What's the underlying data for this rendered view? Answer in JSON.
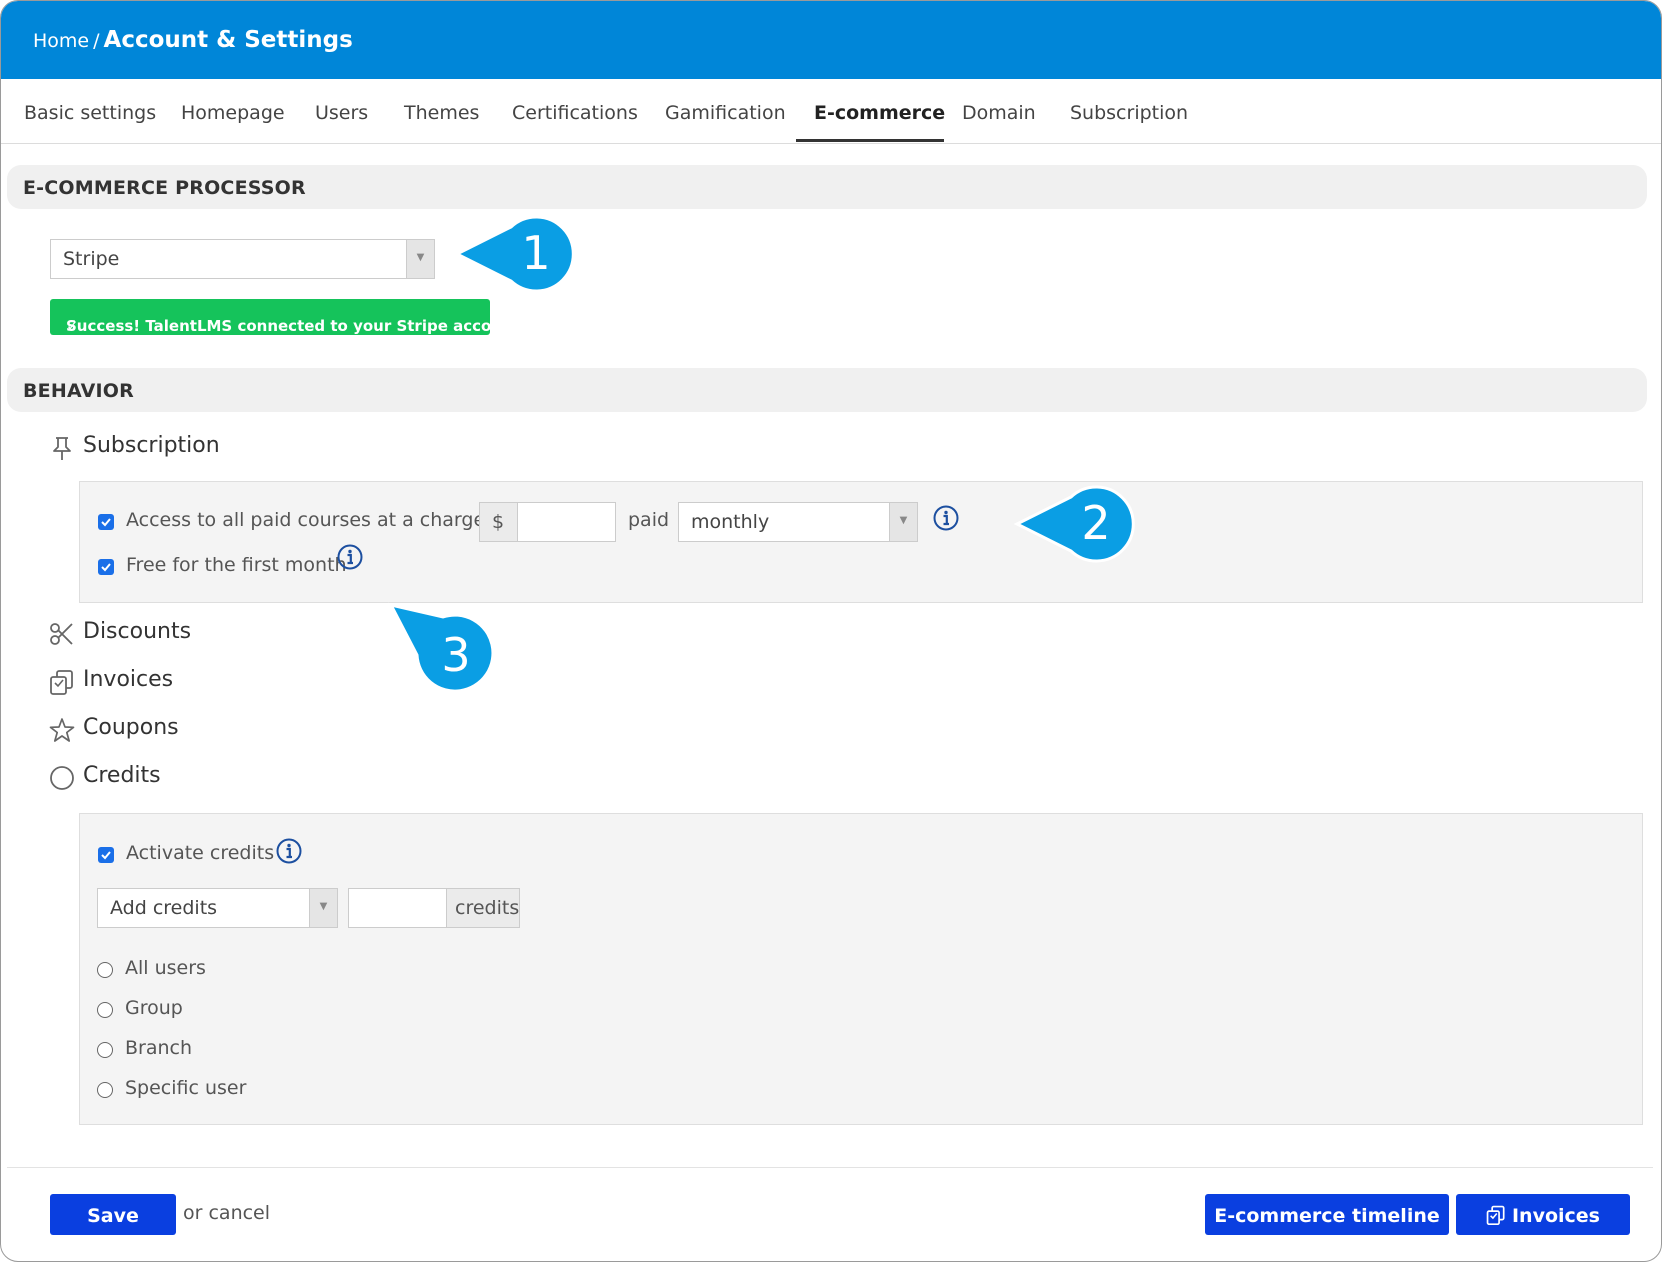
{
  "breadcrumb": {
    "home": "Home",
    "separator": "/",
    "current": "Account & Settings"
  },
  "tabs": [
    "Basic settings",
    "Homepage",
    "Users",
    "Themes",
    "Certifications",
    "Gamification",
    "E-commerce",
    "Domain",
    "Subscription"
  ],
  "active_tab": "E-commerce",
  "processor": {
    "heading": "E-COMMERCE PROCESSOR",
    "selected": "Stripe",
    "success_message": "Success! TalentLMS connected to your Stripe account."
  },
  "behavior": {
    "heading": "BEHAVIOR",
    "subscription": {
      "label": "Subscription",
      "access_label": "Access to all paid courses at a charge of",
      "access_checked": true,
      "currency": "$",
      "amount": "",
      "paid_label": "paid",
      "period": "monthly",
      "free_label": "Free for the first month",
      "free_checked": true
    },
    "discounts_label": "Discounts",
    "invoices_label": "Invoices",
    "coupons_label": "Coupons",
    "credits": {
      "label": "Credits",
      "activate_label": "Activate credits",
      "activate_checked": true,
      "action": "Add credits",
      "amount": "",
      "unit": "credits",
      "targets": [
        "All users",
        "Group",
        "Branch",
        "Specific user"
      ]
    }
  },
  "callouts": [
    "1",
    "2",
    "3"
  ],
  "footer": {
    "save": "Save",
    "cancel": "or cancel",
    "timeline": "E-commerce timeline",
    "invoices": "Invoices"
  },
  "colors": {
    "topbar": "#0086d8",
    "callout": "#0a9ee4",
    "success": "#15c35b",
    "primary_button": "#0a3fe0",
    "checkbox": "#1a6fe8"
  }
}
